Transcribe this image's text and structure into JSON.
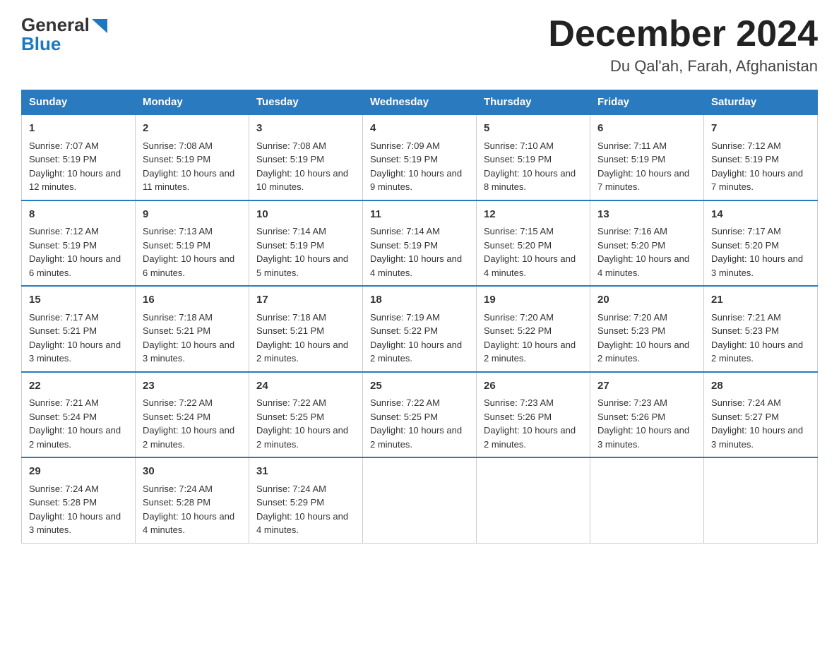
{
  "header": {
    "logo": {
      "general": "General",
      "blue": "Blue"
    },
    "title": "December 2024",
    "location": "Du Qal'ah, Farah, Afghanistan"
  },
  "columns": [
    "Sunday",
    "Monday",
    "Tuesday",
    "Wednesday",
    "Thursday",
    "Friday",
    "Saturday"
  ],
  "weeks": [
    [
      {
        "day": "1",
        "sunrise": "Sunrise: 7:07 AM",
        "sunset": "Sunset: 5:19 PM",
        "daylight": "Daylight: 10 hours and 12 minutes."
      },
      {
        "day": "2",
        "sunrise": "Sunrise: 7:08 AM",
        "sunset": "Sunset: 5:19 PM",
        "daylight": "Daylight: 10 hours and 11 minutes."
      },
      {
        "day": "3",
        "sunrise": "Sunrise: 7:08 AM",
        "sunset": "Sunset: 5:19 PM",
        "daylight": "Daylight: 10 hours and 10 minutes."
      },
      {
        "day": "4",
        "sunrise": "Sunrise: 7:09 AM",
        "sunset": "Sunset: 5:19 PM",
        "daylight": "Daylight: 10 hours and 9 minutes."
      },
      {
        "day": "5",
        "sunrise": "Sunrise: 7:10 AM",
        "sunset": "Sunset: 5:19 PM",
        "daylight": "Daylight: 10 hours and 8 minutes."
      },
      {
        "day": "6",
        "sunrise": "Sunrise: 7:11 AM",
        "sunset": "Sunset: 5:19 PM",
        "daylight": "Daylight: 10 hours and 7 minutes."
      },
      {
        "day": "7",
        "sunrise": "Sunrise: 7:12 AM",
        "sunset": "Sunset: 5:19 PM",
        "daylight": "Daylight: 10 hours and 7 minutes."
      }
    ],
    [
      {
        "day": "8",
        "sunrise": "Sunrise: 7:12 AM",
        "sunset": "Sunset: 5:19 PM",
        "daylight": "Daylight: 10 hours and 6 minutes."
      },
      {
        "day": "9",
        "sunrise": "Sunrise: 7:13 AM",
        "sunset": "Sunset: 5:19 PM",
        "daylight": "Daylight: 10 hours and 6 minutes."
      },
      {
        "day": "10",
        "sunrise": "Sunrise: 7:14 AM",
        "sunset": "Sunset: 5:19 PM",
        "daylight": "Daylight: 10 hours and 5 minutes."
      },
      {
        "day": "11",
        "sunrise": "Sunrise: 7:14 AM",
        "sunset": "Sunset: 5:19 PM",
        "daylight": "Daylight: 10 hours and 4 minutes."
      },
      {
        "day": "12",
        "sunrise": "Sunrise: 7:15 AM",
        "sunset": "Sunset: 5:20 PM",
        "daylight": "Daylight: 10 hours and 4 minutes."
      },
      {
        "day": "13",
        "sunrise": "Sunrise: 7:16 AM",
        "sunset": "Sunset: 5:20 PM",
        "daylight": "Daylight: 10 hours and 4 minutes."
      },
      {
        "day": "14",
        "sunrise": "Sunrise: 7:17 AM",
        "sunset": "Sunset: 5:20 PM",
        "daylight": "Daylight: 10 hours and 3 minutes."
      }
    ],
    [
      {
        "day": "15",
        "sunrise": "Sunrise: 7:17 AM",
        "sunset": "Sunset: 5:21 PM",
        "daylight": "Daylight: 10 hours and 3 minutes."
      },
      {
        "day": "16",
        "sunrise": "Sunrise: 7:18 AM",
        "sunset": "Sunset: 5:21 PM",
        "daylight": "Daylight: 10 hours and 3 minutes."
      },
      {
        "day": "17",
        "sunrise": "Sunrise: 7:18 AM",
        "sunset": "Sunset: 5:21 PM",
        "daylight": "Daylight: 10 hours and 2 minutes."
      },
      {
        "day": "18",
        "sunrise": "Sunrise: 7:19 AM",
        "sunset": "Sunset: 5:22 PM",
        "daylight": "Daylight: 10 hours and 2 minutes."
      },
      {
        "day": "19",
        "sunrise": "Sunrise: 7:20 AM",
        "sunset": "Sunset: 5:22 PM",
        "daylight": "Daylight: 10 hours and 2 minutes."
      },
      {
        "day": "20",
        "sunrise": "Sunrise: 7:20 AM",
        "sunset": "Sunset: 5:23 PM",
        "daylight": "Daylight: 10 hours and 2 minutes."
      },
      {
        "day": "21",
        "sunrise": "Sunrise: 7:21 AM",
        "sunset": "Sunset: 5:23 PM",
        "daylight": "Daylight: 10 hours and 2 minutes."
      }
    ],
    [
      {
        "day": "22",
        "sunrise": "Sunrise: 7:21 AM",
        "sunset": "Sunset: 5:24 PM",
        "daylight": "Daylight: 10 hours and 2 minutes."
      },
      {
        "day": "23",
        "sunrise": "Sunrise: 7:22 AM",
        "sunset": "Sunset: 5:24 PM",
        "daylight": "Daylight: 10 hours and 2 minutes."
      },
      {
        "day": "24",
        "sunrise": "Sunrise: 7:22 AM",
        "sunset": "Sunset: 5:25 PM",
        "daylight": "Daylight: 10 hours and 2 minutes."
      },
      {
        "day": "25",
        "sunrise": "Sunrise: 7:22 AM",
        "sunset": "Sunset: 5:25 PM",
        "daylight": "Daylight: 10 hours and 2 minutes."
      },
      {
        "day": "26",
        "sunrise": "Sunrise: 7:23 AM",
        "sunset": "Sunset: 5:26 PM",
        "daylight": "Daylight: 10 hours and 2 minutes."
      },
      {
        "day": "27",
        "sunrise": "Sunrise: 7:23 AM",
        "sunset": "Sunset: 5:26 PM",
        "daylight": "Daylight: 10 hours and 3 minutes."
      },
      {
        "day": "28",
        "sunrise": "Sunrise: 7:24 AM",
        "sunset": "Sunset: 5:27 PM",
        "daylight": "Daylight: 10 hours and 3 minutes."
      }
    ],
    [
      {
        "day": "29",
        "sunrise": "Sunrise: 7:24 AM",
        "sunset": "Sunset: 5:28 PM",
        "daylight": "Daylight: 10 hours and 3 minutes."
      },
      {
        "day": "30",
        "sunrise": "Sunrise: 7:24 AM",
        "sunset": "Sunset: 5:28 PM",
        "daylight": "Daylight: 10 hours and 4 minutes."
      },
      {
        "day": "31",
        "sunrise": "Sunrise: 7:24 AM",
        "sunset": "Sunset: 5:29 PM",
        "daylight": "Daylight: 10 hours and 4 minutes."
      },
      null,
      null,
      null,
      null
    ]
  ]
}
